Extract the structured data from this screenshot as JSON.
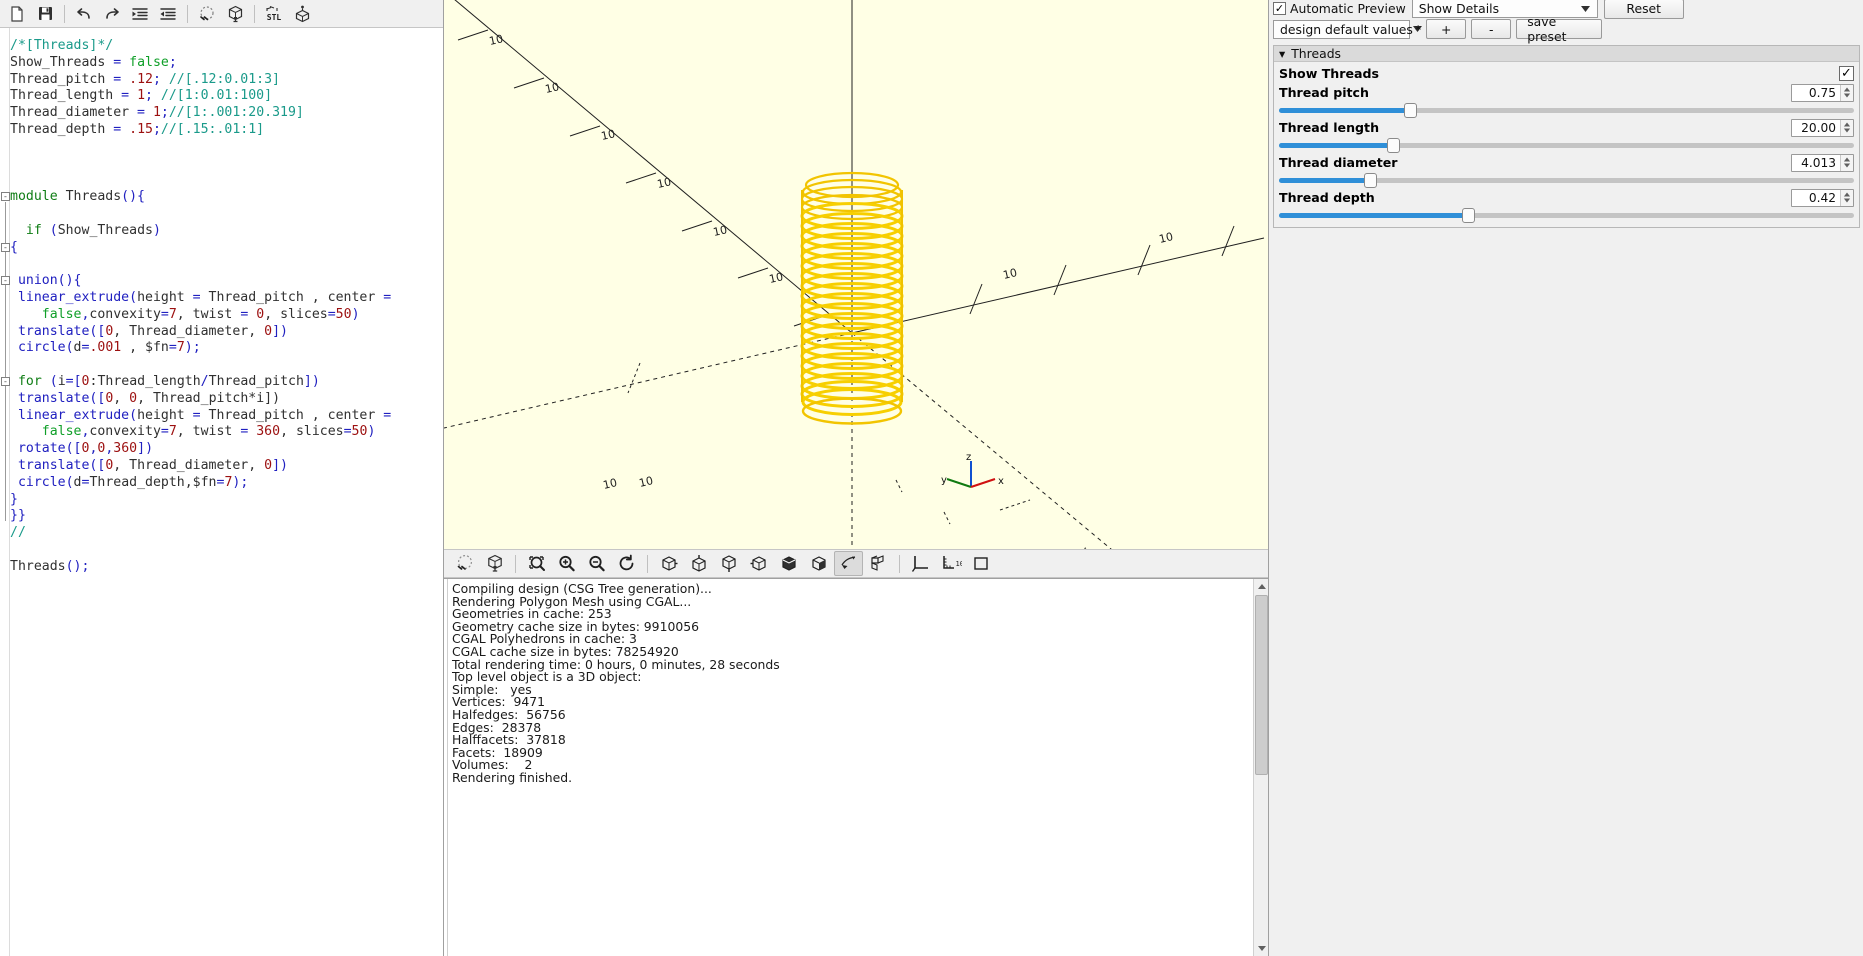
{
  "editor": {
    "toolbar_buttons": [
      {
        "name": "new-icon",
        "label": "New"
      },
      {
        "name": "save-icon",
        "label": "Save"
      },
      {
        "name": "undo-icon",
        "label": "Undo"
      },
      {
        "name": "redo-icon",
        "label": "Redo"
      },
      {
        "name": "unindent-icon",
        "label": "Unindent"
      },
      {
        "name": "indent-icon",
        "label": "Indent"
      },
      {
        "name": "preview-icon",
        "label": "Preview"
      },
      {
        "name": "render-icon",
        "label": "Render"
      },
      {
        "name": "export-stl-icon",
        "label": "STL"
      },
      {
        "name": "view-object-icon",
        "label": "View"
      }
    ],
    "code_lines": [
      {
        "i": 0,
        "tokens": [
          {
            "t": "/*[Threads]*/",
            "c": "cmt"
          }
        ]
      },
      {
        "i": 1,
        "tokens": [
          {
            "t": "Show_Threads ",
            "c": "plain"
          },
          {
            "t": "=",
            "c": "op"
          },
          {
            "t": " ",
            "c": "plain"
          },
          {
            "t": "false",
            "c": "bool"
          },
          {
            "t": ";",
            "c": "pnc"
          }
        ]
      },
      {
        "i": 2,
        "tokens": [
          {
            "t": "Thread_pitch ",
            "c": "plain"
          },
          {
            "t": "=",
            "c": "op"
          },
          {
            "t": " ",
            "c": "plain"
          },
          {
            "t": ".12",
            "c": "num"
          },
          {
            "t": ";",
            "c": "pnc"
          },
          {
            "t": " //[.12:0.01:3]",
            "c": "cmt"
          }
        ]
      },
      {
        "i": 3,
        "tokens": [
          {
            "t": "Thread_length ",
            "c": "plain"
          },
          {
            "t": "=",
            "c": "op"
          },
          {
            "t": " ",
            "c": "plain"
          },
          {
            "t": "1",
            "c": "num"
          },
          {
            "t": ";",
            "c": "pnc"
          },
          {
            "t": " //[1:0.01:100]",
            "c": "cmt"
          }
        ]
      },
      {
        "i": 4,
        "tokens": [
          {
            "t": "Thread_diameter ",
            "c": "plain"
          },
          {
            "t": "=",
            "c": "op"
          },
          {
            "t": " ",
            "c": "plain"
          },
          {
            "t": "1",
            "c": "num"
          },
          {
            "t": ";",
            "c": "pnc"
          },
          {
            "t": "//[1:.001:20.319]",
            "c": "cmt"
          }
        ]
      },
      {
        "i": 5,
        "tokens": [
          {
            "t": "Thread_depth ",
            "c": "plain"
          },
          {
            "t": "=",
            "c": "op"
          },
          {
            "t": " ",
            "c": "plain"
          },
          {
            "t": ".15",
            "c": "num"
          },
          {
            "t": ";",
            "c": "pnc"
          },
          {
            "t": "//[.15:.01:1]",
            "c": "cmt"
          }
        ]
      },
      {
        "i": 6,
        "tokens": []
      },
      {
        "i": 7,
        "tokens": []
      },
      {
        "i": 8,
        "tokens": []
      },
      {
        "i": 9,
        "tokens": [
          {
            "t": "module",
            "c": "kw"
          },
          {
            "t": " Threads",
            "c": "plain"
          },
          {
            "t": "(){",
            "c": "pnc"
          }
        ]
      },
      {
        "i": 10,
        "tokens": []
      },
      {
        "i": 11,
        "tokens": [
          {
            "t": "  ",
            "c": "plain"
          },
          {
            "t": "if",
            "c": "kw"
          },
          {
            "t": " ",
            "c": "plain"
          },
          {
            "t": "(",
            "c": "pnc"
          },
          {
            "t": "Show_Threads",
            "c": "plain"
          },
          {
            "t": ")",
            "c": "pnc"
          }
        ]
      },
      {
        "i": 12,
        "tokens": [
          {
            "t": "{",
            "c": "pnc"
          }
        ]
      },
      {
        "i": 13,
        "tokens": []
      },
      {
        "i": 14,
        "tokens": [
          {
            "t": " ",
            "c": "plain"
          },
          {
            "t": "union",
            "c": "mod"
          },
          {
            "t": "(){",
            "c": "pnc"
          }
        ]
      },
      {
        "i": 15,
        "tokens": [
          {
            "t": " ",
            "c": "plain"
          },
          {
            "t": "linear_extrude",
            "c": "mod"
          },
          {
            "t": "(",
            "c": "pnc"
          },
          {
            "t": "height ",
            "c": "plain"
          },
          {
            "t": "=",
            "c": "op"
          },
          {
            "t": " Thread_pitch , center ",
            "c": "plain"
          },
          {
            "t": "=",
            "c": "op"
          }
        ]
      },
      {
        "i": 16,
        "tokens": [
          {
            "t": "    ",
            "c": "plain"
          },
          {
            "t": "false",
            "c": "bool"
          },
          {
            "t": ",",
            "c": "pnc"
          },
          {
            "t": "convexity",
            "c": "plain"
          },
          {
            "t": "=",
            "c": "op"
          },
          {
            "t": "7",
            "c": "num"
          },
          {
            "t": ", twist ",
            "c": "plain"
          },
          {
            "t": "=",
            "c": "op"
          },
          {
            "t": " ",
            "c": "plain"
          },
          {
            "t": "0",
            "c": "num"
          },
          {
            "t": ", slices",
            "c": "plain"
          },
          {
            "t": "=",
            "c": "op"
          },
          {
            "t": "50",
            "c": "num"
          },
          {
            "t": ")",
            "c": "pnc"
          }
        ]
      },
      {
        "i": 17,
        "tokens": [
          {
            "t": " ",
            "c": "plain"
          },
          {
            "t": "translate",
            "c": "mod"
          },
          {
            "t": "([",
            "c": "pnc"
          },
          {
            "t": "0",
            "c": "num"
          },
          {
            "t": ", Thread_diameter, ",
            "c": "plain"
          },
          {
            "t": "0",
            "c": "num"
          },
          {
            "t": "])",
            "c": "pnc"
          }
        ]
      },
      {
        "i": 18,
        "tokens": [
          {
            "t": " ",
            "c": "plain"
          },
          {
            "t": "circle",
            "c": "mod"
          },
          {
            "t": "(",
            "c": "pnc"
          },
          {
            "t": "d",
            "c": "plain"
          },
          {
            "t": "=",
            "c": "op"
          },
          {
            "t": ".001",
            "c": "num"
          },
          {
            "t": " , ",
            "c": "plain"
          },
          {
            "t": "$fn",
            "c": "plain"
          },
          {
            "t": "=",
            "c": "op"
          },
          {
            "t": "7",
            "c": "num"
          },
          {
            "t": ");",
            "c": "pnc"
          }
        ]
      },
      {
        "i": 19,
        "tokens": []
      },
      {
        "i": 20,
        "tokens": [
          {
            "t": " ",
            "c": "plain"
          },
          {
            "t": "for",
            "c": "kw"
          },
          {
            "t": " ",
            "c": "plain"
          },
          {
            "t": "(",
            "c": "pnc"
          },
          {
            "t": "i",
            "c": "plain"
          },
          {
            "t": "=",
            "c": "op"
          },
          {
            "t": "[",
            "c": "pnc"
          },
          {
            "t": "0",
            "c": "num"
          },
          {
            "t": ":",
            "c": "plain"
          },
          {
            "t": "Thread_length",
            "c": "plain"
          },
          {
            "t": "/",
            "c": "op"
          },
          {
            "t": "Thread_pitch",
            "c": "plain"
          },
          {
            "t": "])",
            "c": "pnc"
          }
        ]
      },
      {
        "i": 21,
        "tokens": [
          {
            "t": " ",
            "c": "plain"
          },
          {
            "t": "translate",
            "c": "mod"
          },
          {
            "t": "([",
            "c": "pnc"
          },
          {
            "t": "0",
            "c": "num"
          },
          {
            "t": ", ",
            "c": "plain"
          },
          {
            "t": "0",
            "c": "num"
          },
          {
            "t": ", Thread_pitch*i])",
            "c": "plain"
          }
        ]
      },
      {
        "i": 22,
        "tokens": [
          {
            "t": " ",
            "c": "plain"
          },
          {
            "t": "linear_extrude",
            "c": "mod"
          },
          {
            "t": "(",
            "c": "pnc"
          },
          {
            "t": "height ",
            "c": "plain"
          },
          {
            "t": "=",
            "c": "op"
          },
          {
            "t": " Thread_pitch , center ",
            "c": "plain"
          },
          {
            "t": "=",
            "c": "op"
          }
        ]
      },
      {
        "i": 23,
        "tokens": [
          {
            "t": "    ",
            "c": "plain"
          },
          {
            "t": "false",
            "c": "bool"
          },
          {
            "t": ",",
            "c": "pnc"
          },
          {
            "t": "convexity",
            "c": "plain"
          },
          {
            "t": "=",
            "c": "op"
          },
          {
            "t": "7",
            "c": "num"
          },
          {
            "t": ", twist ",
            "c": "plain"
          },
          {
            "t": "=",
            "c": "op"
          },
          {
            "t": " ",
            "c": "plain"
          },
          {
            "t": "360",
            "c": "num"
          },
          {
            "t": ", slices",
            "c": "plain"
          },
          {
            "t": "=",
            "c": "op"
          },
          {
            "t": "50",
            "c": "num"
          },
          {
            "t": ")",
            "c": "pnc"
          }
        ]
      },
      {
        "i": 24,
        "tokens": [
          {
            "t": " ",
            "c": "plain"
          },
          {
            "t": "rotate",
            "c": "mod"
          },
          {
            "t": "([",
            "c": "pnc"
          },
          {
            "t": "0",
            "c": "num"
          },
          {
            "t": ",",
            "c": "pnc"
          },
          {
            "t": "0",
            "c": "num"
          },
          {
            "t": ",",
            "c": "pnc"
          },
          {
            "t": "360",
            "c": "num"
          },
          {
            "t": "])",
            "c": "pnc"
          }
        ]
      },
      {
        "i": 25,
        "tokens": [
          {
            "t": " ",
            "c": "plain"
          },
          {
            "t": "translate",
            "c": "mod"
          },
          {
            "t": "([",
            "c": "pnc"
          },
          {
            "t": "0",
            "c": "num"
          },
          {
            "t": ", Thread_diameter, ",
            "c": "plain"
          },
          {
            "t": "0",
            "c": "num"
          },
          {
            "t": "])",
            "c": "pnc"
          }
        ]
      },
      {
        "i": 26,
        "tokens": [
          {
            "t": " ",
            "c": "plain"
          },
          {
            "t": "circle",
            "c": "mod"
          },
          {
            "t": "(",
            "c": "pnc"
          },
          {
            "t": "d",
            "c": "plain"
          },
          {
            "t": "=",
            "c": "op"
          },
          {
            "t": "Thread_depth,",
            "c": "plain"
          },
          {
            "t": "$fn",
            "c": "plain"
          },
          {
            "t": "=",
            "c": "op"
          },
          {
            "t": "7",
            "c": "num"
          },
          {
            "t": ");",
            "c": "pnc"
          }
        ]
      },
      {
        "i": 27,
        "tokens": [
          {
            "t": "}",
            "c": "pnc"
          }
        ]
      },
      {
        "i": 28,
        "tokens": [
          {
            "t": "}}",
            "c": "pnc"
          }
        ]
      },
      {
        "i": 29,
        "tokens": [
          {
            "t": "//",
            "c": "cmt"
          }
        ]
      },
      {
        "i": 30,
        "tokens": []
      },
      {
        "i": 31,
        "tokens": [
          {
            "t": "Threads",
            "c": "plain"
          },
          {
            "t": "();",
            "c": "pnc"
          }
        ]
      }
    ]
  },
  "viewport": {
    "axis_labels": {
      "x": "x",
      "y": "y",
      "z": "z"
    },
    "model_color": "#f9d814",
    "background_color": "#ffffe5",
    "tick_labels": [
      "10",
      "10",
      "10",
      "10",
      "10",
      "10",
      "10",
      "10",
      "10",
      "10"
    ],
    "toolbar_buttons": [
      {
        "name": "preview-icon",
        "label": "Preview",
        "active": false
      },
      {
        "name": "render-icon",
        "label": "Render",
        "active": false
      },
      {
        "name": "zoom-all-icon",
        "label": "View All",
        "active": false
      },
      {
        "name": "zoom-in-icon",
        "label": "Zoom In",
        "active": false
      },
      {
        "name": "zoom-out-icon",
        "label": "Zoom Out",
        "active": false
      },
      {
        "name": "reset-view-icon",
        "label": "Reset View",
        "active": false
      },
      {
        "name": "right-view-icon",
        "label": "Right",
        "active": false
      },
      {
        "name": "top-view-icon",
        "label": "Top",
        "active": false
      },
      {
        "name": "bottom-view-icon",
        "label": "Bottom",
        "active": false
      },
      {
        "name": "left-view-icon",
        "label": "Left",
        "active": false
      },
      {
        "name": "front-view-icon",
        "label": "Front",
        "active": false
      },
      {
        "name": "back-view-icon",
        "label": "Back",
        "active": false
      },
      {
        "name": "show-edges-icon",
        "label": "Show Edges",
        "active": true
      },
      {
        "name": "perspective-icon",
        "label": "Perspective",
        "active": false
      },
      {
        "name": "show-axes-icon",
        "label": "Show Axes",
        "active": false
      },
      {
        "name": "show-scale-icon",
        "label": "Show Scale Markers",
        "active": false
      },
      {
        "name": "show-crosshairs-icon",
        "label": "Show Crosshairs",
        "active": false
      }
    ]
  },
  "console": {
    "lines": [
      "Compiling design (CSG Tree generation)...",
      "Rendering Polygon Mesh using CGAL...",
      "Geometries in cache: 253",
      "Geometry cache size in bytes: 9910056",
      "CGAL Polyhedrons in cache: 3",
      "CGAL cache size in bytes: 78254920",
      "Total rendering time: 0 hours, 0 minutes, 28 seconds",
      "Top level object is a 3D object:",
      "Simple:   yes",
      "Vertices:  9471",
      "Halfedges:  56756",
      "Edges:  28378",
      "Halffacets:  37818",
      "Facets:  18909",
      "Volumes:    2",
      "Rendering finished."
    ]
  },
  "customizer": {
    "automatic_preview_label": "Automatic Preview",
    "automatic_preview_checked": true,
    "checkmark": "✓",
    "show_details_label": "Show Details",
    "reset_label": "Reset",
    "preset_value": "design default values",
    "asterisk": "*",
    "add_label": "+",
    "remove_label": "-",
    "save_preset_label": "save preset",
    "group": {
      "title": "Threads",
      "collapse_glyph": "▾",
      "params": [
        {
          "name": "show-threads",
          "label": "Show Threads",
          "type": "checkbox",
          "checked": true,
          "value": "✓"
        },
        {
          "name": "thread-pitch",
          "label": "Thread pitch",
          "type": "slider",
          "value": "0.75",
          "fill_percent": 23
        },
        {
          "name": "thread-length",
          "label": "Thread length",
          "type": "slider",
          "value": "20.00",
          "fill_percent": 20
        },
        {
          "name": "thread-diameter",
          "label": "Thread diameter",
          "type": "slider",
          "value": "4.013",
          "fill_percent": 16
        },
        {
          "name": "thread-depth",
          "label": "Thread depth",
          "type": "slider",
          "value": "0.42",
          "fill_percent": 33
        }
      ]
    }
  }
}
